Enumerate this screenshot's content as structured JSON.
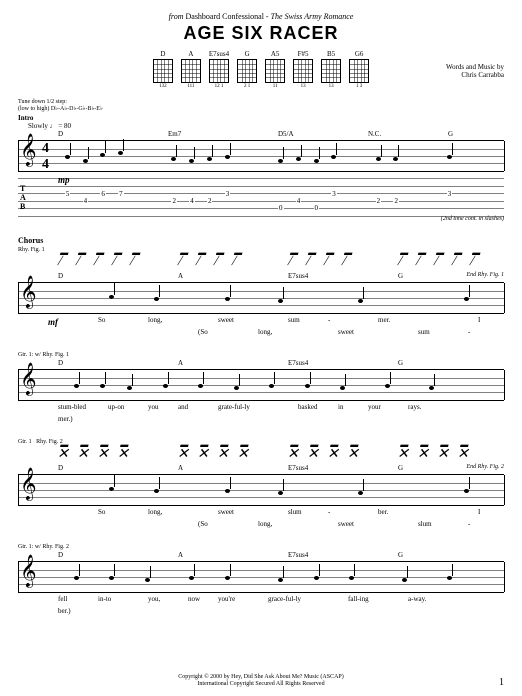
{
  "header": {
    "from_prefix": "from ",
    "band": "Dashboard Confessional",
    "album_sep": " - ",
    "album": "The Swiss Army Romance",
    "title": "AGE SIX RACER"
  },
  "chords": [
    {
      "name": "D",
      "fret": "132"
    },
    {
      "name": "A",
      "fret": "111"
    },
    {
      "name": "E7sus4",
      "fret": "12 1"
    },
    {
      "name": "G",
      "fret": "2 1"
    },
    {
      "name": "A5",
      "fret": "11"
    },
    {
      "name": "F#5",
      "fret": "13"
    },
    {
      "name": "B5",
      "fret": "13"
    },
    {
      "name": "G6",
      "fret": "1 3"
    }
  ],
  "credits": {
    "line1": "Words and Music by",
    "line2": "Chris Carrabba"
  },
  "tuning": {
    "line1": "Tune down 1/2 step:",
    "line2": "(low to high) D♭-A♭-D♭-G♭-B♭-E♭"
  },
  "intro": {
    "label": "Intro",
    "tempo": "Slowly ♩ = 80",
    "chords": [
      "D",
      "Em7",
      "D5/A",
      "N.C.",
      "G"
    ],
    "dynamic": "mp",
    "tab_main": [
      "5",
      "4",
      "6",
      "7",
      "2",
      "4",
      "2",
      "3",
      "0",
      "4",
      "0",
      "3",
      "2",
      "2",
      "3"
    ],
    "note_right": "(2nd time cont. in slashes)"
  },
  "chorus": {
    "label": "Chorus",
    "systems": [
      {
        "rhy": "Rhy. Fig. 1",
        "chords": [
          "D",
          "A",
          "E7sus4",
          "G"
        ],
        "end": "End Rhy. Fig. 1",
        "dynamic": "mf",
        "lyrics_top": [
          "So",
          "long,",
          "sweet",
          "sum",
          "-",
          "mer.",
          "I"
        ],
        "lyrics_bot": [
          "(So",
          "long,",
          "sweet",
          "sum",
          "-"
        ]
      },
      {
        "rhy": "Gtr. 1: w/ Rhy. Fig. 1",
        "chords": [
          "D",
          "A",
          "E7sus4",
          "G"
        ],
        "lyrics_top": [
          "stum-bled",
          "up-on",
          "you",
          "and",
          "grate-ful-ly",
          "basked",
          "in",
          "your",
          "rays."
        ],
        "lyrics_bot": [
          "mer.)"
        ]
      },
      {
        "rhy": "Rhy. Fig. 2",
        "gtr": "Gtr. 1",
        "chords": [
          "D",
          "A",
          "E7sus4",
          "G"
        ],
        "end": "End Rhy. Fig. 2",
        "lyrics_top": [
          "So",
          "long,",
          "sweet",
          "slum",
          "-",
          "ber.",
          "I"
        ],
        "lyrics_bot": [
          "(So",
          "long,",
          "sweet",
          "slum",
          "-"
        ]
      },
      {
        "rhy": "Gtr. 1: w/ Rhy. Fig. 2",
        "chords": [
          "D",
          "A",
          "E7sus4",
          "G"
        ],
        "lyrics_top": [
          "fell",
          "in-to",
          "you,",
          "now",
          "you're",
          "grace-ful-ly",
          "fall-ing",
          "a-way."
        ],
        "lyrics_bot": [
          "ber.)"
        ]
      }
    ]
  },
  "footer": {
    "copyright": "Copyright © 2000 by Hey, Did She Ask About Me? Music (ASCAP)",
    "rights": "International Copyright Secured   All Rights Reserved"
  },
  "page": "1"
}
